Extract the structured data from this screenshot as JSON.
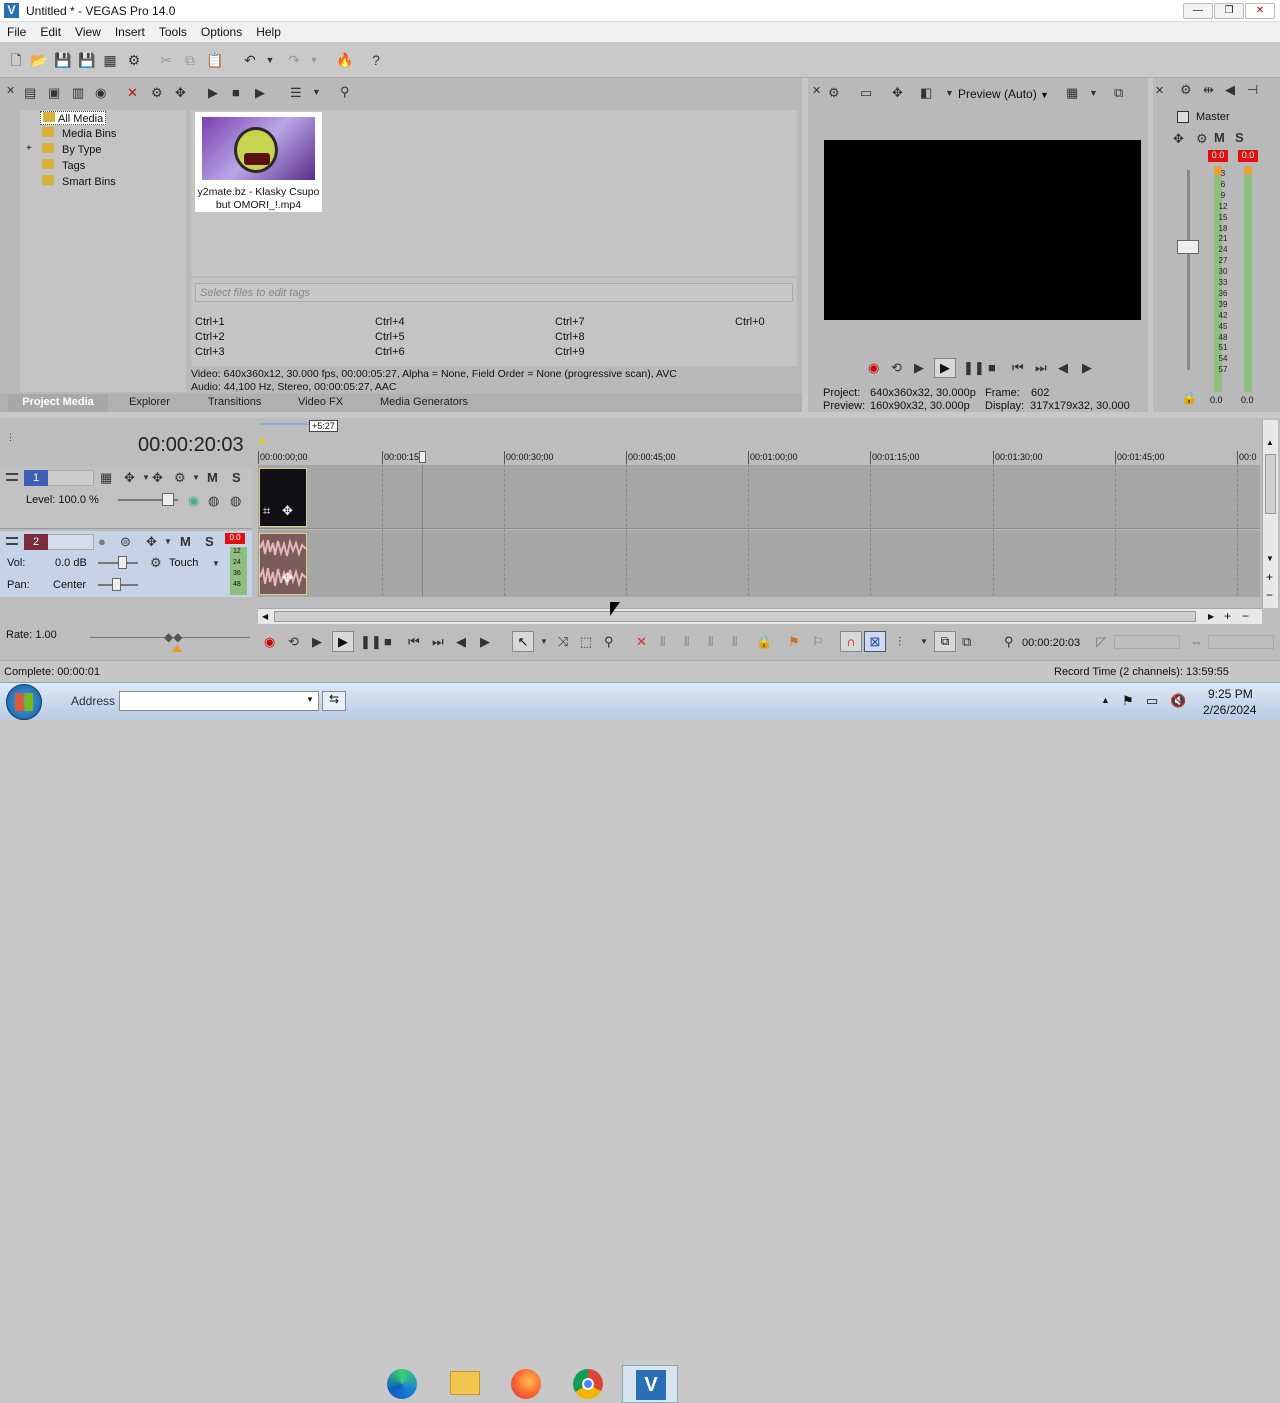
{
  "window": {
    "title": "Untitled * - VEGAS Pro 14.0",
    "app_icon": "vegas-logo-icon"
  },
  "menu": [
    "File",
    "Edit",
    "View",
    "Insert",
    "Tools",
    "Options",
    "Help"
  ],
  "media_tree": {
    "items": [
      "All Media",
      "Media Bins",
      "By Type",
      "Tags",
      "Smart Bins"
    ],
    "expander": "+"
  },
  "media_file": {
    "name_line1": "y2mate.bz - Klasky Csupo",
    "name_line2": "but OMORI_!.mp4"
  },
  "tags": {
    "placeholder": "Select files to edit tags",
    "shortcuts": [
      "Ctrl+1",
      "Ctrl+4",
      "Ctrl+7",
      "Ctrl+0",
      "Ctrl+2",
      "Ctrl+5",
      "Ctrl+8",
      "Ctrl+3",
      "Ctrl+6",
      "Ctrl+9"
    ]
  },
  "media_info": {
    "video": "Video: 640x360x12, 30.000 fps, 00:00:05:27, Alpha = None, Field Order = None (progressive scan), AVC",
    "audio": "Audio: 44,100 Hz, Stereo, 00:00:05:27, AAC"
  },
  "tabs": [
    "Project Media",
    "Explorer",
    "Transitions",
    "Video FX",
    "Media Generators"
  ],
  "preview": {
    "mode": "Preview (Auto)",
    "project_label": "Project:",
    "project_value": "640x360x32, 30.000p",
    "preview_label": "Preview:",
    "preview_value": "160x90x32, 30.000p",
    "frame_label": "Frame:",
    "frame_value": "602",
    "display_label": "Display:",
    "display_value": "317x179x32, 30.000"
  },
  "master": {
    "label": "Master",
    "m": "M",
    "s": "S",
    "peak_left": "0.0",
    "peak_right": "0.0",
    "scale": [
      "3",
      "6",
      "9",
      "12",
      "15",
      "18",
      "21",
      "24",
      "27",
      "30",
      "33",
      "36",
      "39",
      "42",
      "45",
      "48",
      "51",
      "54",
      "57"
    ],
    "bottom_left": "0.0",
    "bottom_right": "0.0"
  },
  "timeline": {
    "current_time": "00:00:20:03",
    "marker_label": "+5:27",
    "ruler": [
      "00:00:00;00",
      "00:00:15",
      "00:00:30;00",
      "00:00:45;00",
      "00:01:00;00",
      "00:01:15;00",
      "00:01:30;00",
      "00:01:45;00",
      "00:0"
    ],
    "tracks": {
      "video": {
        "number": "1",
        "level_label": "Level: 100.0 %",
        "m": "M",
        "s": "S"
      },
      "audio": {
        "number": "2",
        "vol_label": "Vol:",
        "vol_value": "0.0 dB",
        "pan_label": "Pan:",
        "pan_value": "Center",
        "automation": "Touch",
        "m": "M",
        "s": "S",
        "peak": "0.0",
        "scale": [
          "12",
          "24",
          "36",
          "48"
        ]
      }
    },
    "rate": "Rate: 1.00",
    "transport_time": "00:00:20:03"
  },
  "status": {
    "left": "Complete: 00:00:01",
    "right": "Record Time (2 channels): 13:59:55"
  },
  "taskbar": {
    "address_label": "Address",
    "time": "9:25 PM",
    "date": "2/26/2024",
    "apps": [
      "edge-icon",
      "file-explorer-icon",
      "firefox-icon",
      "chrome-icon",
      "vegas-icon"
    ]
  },
  "colors": {
    "accent": "#0078d7",
    "video_event": "#0f0f14",
    "audio_event": "#7b5a5a",
    "meter_red": "#e01010",
    "meter_green": "#8fbf7f"
  }
}
